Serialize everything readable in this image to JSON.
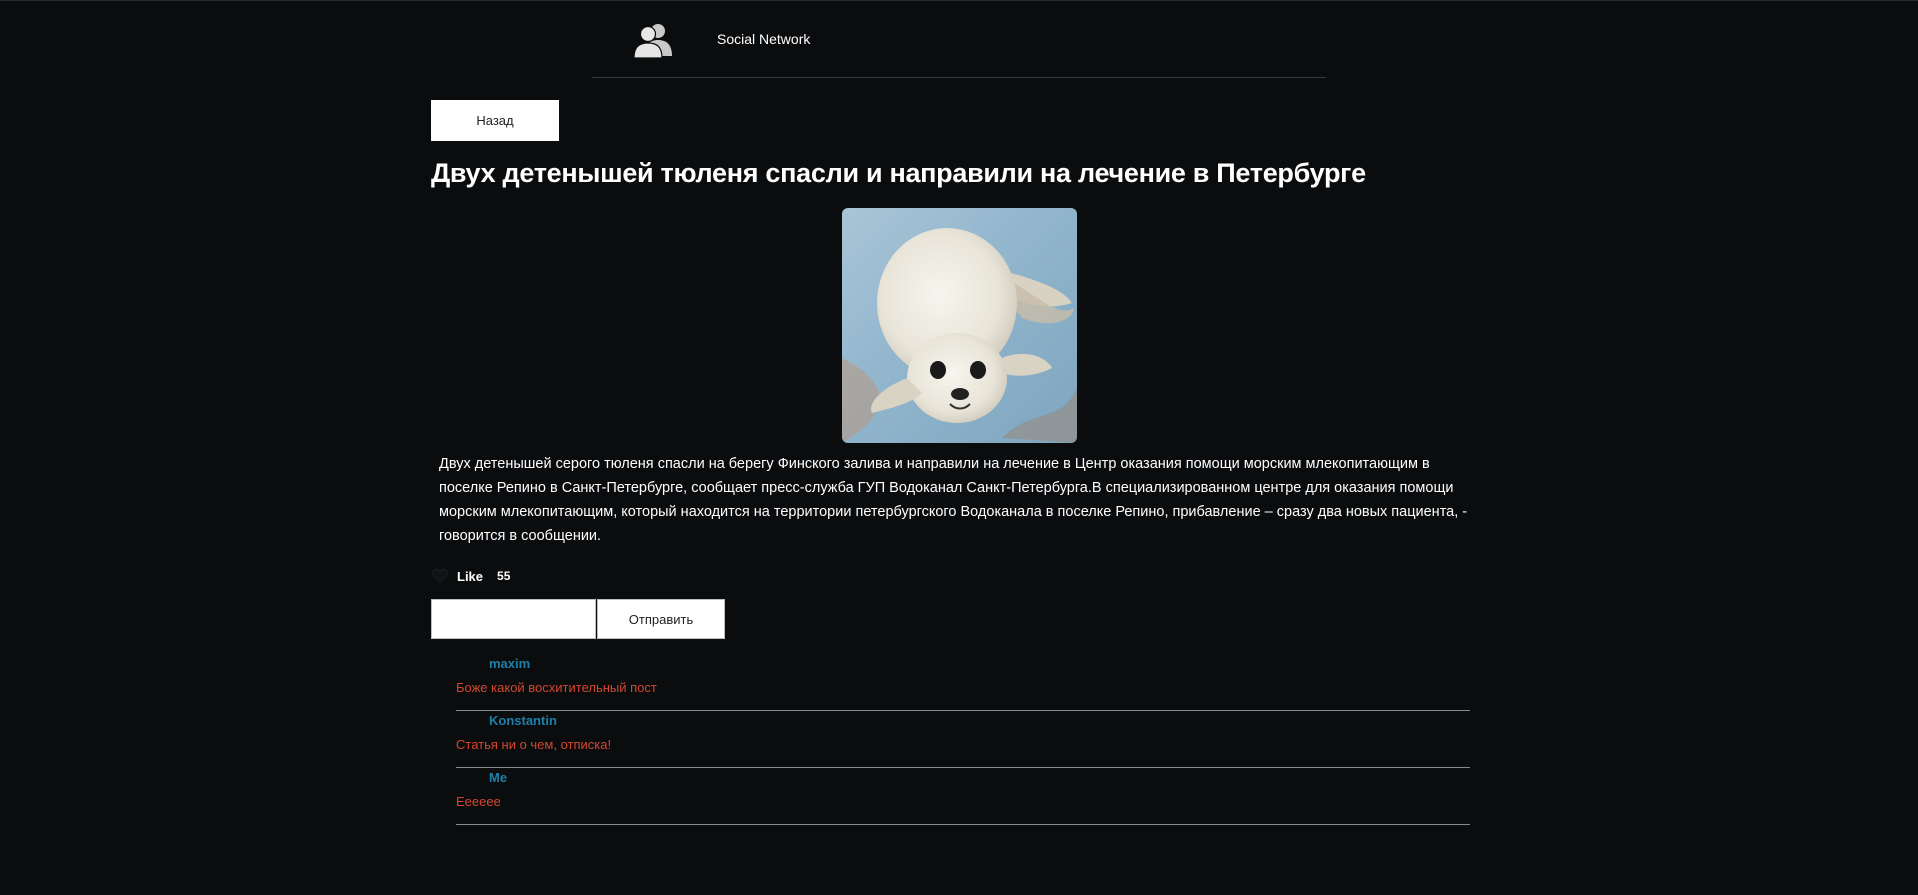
{
  "header": {
    "brand": "Social Network",
    "logo_icon": "users-icon"
  },
  "nav": {
    "back_label": "Назад"
  },
  "post": {
    "title": "Двух детенышей тюленя спасли и направили на лечение в Петербурге",
    "image_subject": "seal-pup",
    "body": "Двух детенышей серого тюленя спасли на берегу Финского залива и направили на лечение в Центр оказания помощи морским млекопитающим в поселке Репино в Санкт-Петербурге, сообщает пресс-служба ГУП Водоканал Санкт-Петербурга.В специализированном центре для оказания помощи морским млекопитающим, который находится на территории петербургского Водоканала в поселке Репино, прибавление – сразу два новых пациента, - говорится в сообщении.",
    "like_label": "Like",
    "like_count": "55"
  },
  "comment_form": {
    "input_value": "",
    "send_label": "Отправить"
  },
  "comments": [
    {
      "author": "maxim",
      "text": "Боже какой восхитительный пост"
    },
    {
      "author": "Konstantin",
      "text": "Статья ни о чем, отписка!"
    },
    {
      "author": "Me",
      "text": "Ееееее"
    }
  ],
  "colors": {
    "background": "#0b0c0e",
    "author": "#1e7fa8",
    "comment_text": "#d4472f"
  }
}
